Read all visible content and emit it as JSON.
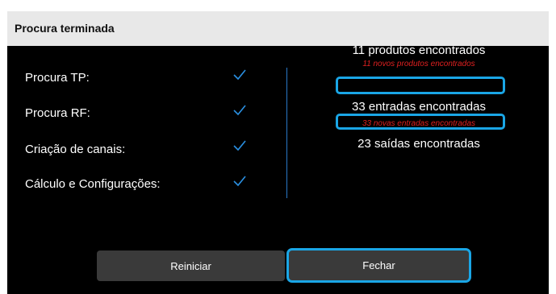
{
  "dialog": {
    "title": "Procura terminada"
  },
  "steps": [
    {
      "label": "Procura TP:",
      "status": "done"
    },
    {
      "label": "Procura RF:",
      "status": "done"
    },
    {
      "label": "Criação de canais:",
      "status": "done"
    },
    {
      "label": "Cálculo e Configurações:",
      "status": "done"
    }
  ],
  "results": {
    "products_found": "11 produtos encontrados",
    "new_products_found": "11 novos produtos encontrados",
    "inputs_found": "33 entradas encontradas",
    "new_inputs_found": "33 novas entradas encontradas",
    "outputs_found": "23 saídas encontradas"
  },
  "buttons": {
    "restart": "Reiniciar",
    "close": "Fechar"
  },
  "colors": {
    "background": "#000000",
    "titlebar": "#e8e8e8",
    "check": "#2a8fe0",
    "highlight": "#1aa6e6",
    "new_text": "#e02020",
    "button": "#3a3a3a"
  },
  "icons": {
    "step_status": "check-icon"
  }
}
